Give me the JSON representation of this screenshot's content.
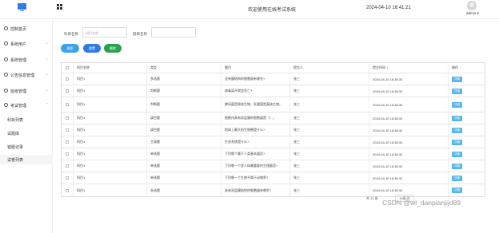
{
  "header": {
    "title": "欢迎使用在线考试系统",
    "time": "2024-04-10 16:41:21",
    "user": "admin ▾"
  },
  "sidebar": {
    "items": [
      {
        "label": "控制首页",
        "icon": "clock-icon"
      },
      {
        "label": "系统用户",
        "icon": "user-icon"
      },
      {
        "label": "系统管理",
        "icon": "folder-icon"
      },
      {
        "label": "公告信息管理",
        "icon": "bell-icon"
      },
      {
        "label": "班级管理",
        "icon": "group-icon"
      },
      {
        "label": "考试管理",
        "icon": "clock-icon"
      }
    ],
    "sub_items": [
      {
        "label": "科目列表"
      },
      {
        "label": "试题库"
      },
      {
        "label": "错题记录"
      },
      {
        "label": "试卷列表"
      }
    ]
  },
  "search": {
    "subject_label": "科目名称",
    "subject_placeholder": "科目名称",
    "question_label": "题目名称",
    "question_placeholder": ""
  },
  "buttons": {
    "search": "搜索",
    "reset": "重置",
    "delete": "删除"
  },
  "table": {
    "headers": [
      "",
      "科目名称",
      "类型",
      "题目",
      "提交人",
      "提交时间 ↕",
      "操作"
    ],
    "detail_label": "详情",
    "rows": [
      {
        "subject": "科目1",
        "type": "多选题",
        "question": "没有膜结构的细胞器有哪些?",
        "submitter": "张三",
        "time": "2024-04-10 16:38:33",
        "tall": false
      },
      {
        "subject": "科目1",
        "type": "判断题",
        "question": "病毒离开就会死亡?",
        "submitter": "张三",
        "time": "2024-04-10 16:38:33",
        "tall": false
      },
      {
        "subject": "科目1",
        "type": "判断题",
        "question": "酵母菌是原核生物，乳酸菌是真核生物。",
        "submitter": "张三",
        "time": "2024-04-10 16:38:33",
        "tall": true
      },
      {
        "subject": "科目1",
        "type": "填空题",
        "question": "细胞内具有双层膜的细胞器是（）。",
        "submitter": "张三",
        "time": "2024-04-10 16:38:33",
        "tall": false
      },
      {
        "subject": "科目1",
        "type": "填空题",
        "question": "地球上最大的生物圈是什么?",
        "submitter": "张三",
        "time": "2024-04-10 16:38:33",
        "tall": false
      },
      {
        "subject": "科目1",
        "type": "主观题",
        "question": "生态系统是什么?",
        "submitter": "张三",
        "time": "2024-04-10 16:38:33",
        "tall": false
      },
      {
        "subject": "科目1",
        "type": "单选题",
        "question": "下列哪个属于人类基本器官?",
        "submitter": "张三",
        "time": "2024-04-10 16:38:32",
        "tall": false
      },
      {
        "subject": "科目1",
        "type": "单选题",
        "question": "下列哪一个是人体最重要的生理器官?",
        "submitter": "张三",
        "time": "2024-04-10 16:38:32",
        "tall": false
      },
      {
        "subject": "科目1",
        "type": "单选题",
        "question": "下列哪一个生物不属于动物界?",
        "submitter": "张三",
        "time": "2024-04-10 16:38:32",
        "tall": false
      },
      {
        "subject": "科目1",
        "type": "多选题",
        "question": "具有双层膜结构的细胞器有哪些?",
        "submitter": "张三",
        "time": "2024-04-10 16:38:32",
        "tall": false
      }
    ]
  },
  "pager": {
    "total": "共 10 条",
    "page_size": "10条/页"
  },
  "watermark": "CSDN @wl_danpianjijd89"
}
